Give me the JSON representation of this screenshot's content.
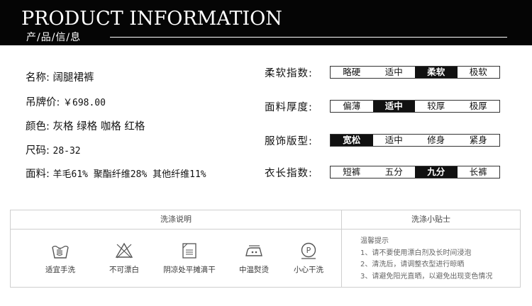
{
  "banner": {
    "title": "PRODUCT INFORMATION",
    "subtitle": "产/品/信/息"
  },
  "product": [
    {
      "label": "名称:",
      "value": "阔腿裙裤"
    },
    {
      "label": "吊牌价:",
      "value": "￥698.00"
    },
    {
      "label": "颜色:",
      "value": "灰格 绿格 咖格 红格"
    },
    {
      "label": "尺码:",
      "value": "28-32"
    },
    {
      "label": "面料:",
      "value": "羊毛61% 聚酯纤维28% 其他纤维11%"
    }
  ],
  "scales": [
    {
      "label": "柔软指数:",
      "options": [
        "略硬",
        "适中",
        "柔软",
        "极软"
      ],
      "selected": "柔软"
    },
    {
      "label": "面料厚度:",
      "options": [
        "偏薄",
        "适中",
        "较厚",
        "极厚"
      ],
      "selected": "适中"
    },
    {
      "label": "服饰版型:",
      "options": [
        "宽松",
        "适中",
        "修身",
        "紧身"
      ],
      "selected": "宽松"
    },
    {
      "label": "衣长指数:",
      "options": [
        "短裤",
        "五分",
        "九分",
        "长裤"
      ],
      "selected": "九分"
    }
  ],
  "care": {
    "title": "洗涤说明",
    "items": [
      {
        "icon": "hand-wash-icon",
        "label": "适宜手洗"
      },
      {
        "icon": "no-bleach-icon",
        "label": "不可漂白"
      },
      {
        "icon": "dry-flat-shade-icon",
        "label": "阴凉处平摊滴干"
      },
      {
        "icon": "iron-medium-icon",
        "label": "中温熨烫"
      },
      {
        "icon": "dry-clean-icon",
        "label": "小心干洗"
      }
    ]
  },
  "tips": {
    "title": "洗涤小贴士",
    "heading": "温馨提示",
    "lines": [
      "1、请不要使用漂白剂及长时间浸泡",
      "2、清洗后，请调整衣型进行晾晒",
      "3、请避免阳光直晒，以避免出现变色情况"
    ]
  }
}
